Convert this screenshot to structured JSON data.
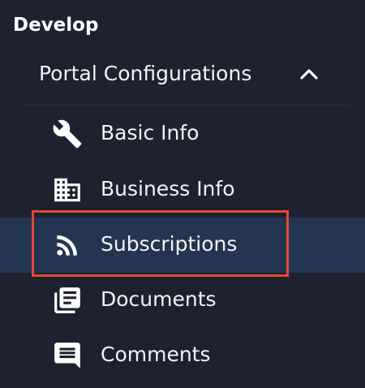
{
  "section": {
    "title": "Develop"
  },
  "group": {
    "label": "Portal Configurations",
    "expanded": true,
    "chevron_icon": "chevron-up-icon"
  },
  "items": [
    {
      "label": "Basic Info",
      "icon": "wrench-icon",
      "active": false
    },
    {
      "label": "Business Info",
      "icon": "building-icon",
      "active": false
    },
    {
      "label": "Subscriptions",
      "icon": "rss-feed-icon",
      "active": true
    },
    {
      "label": "Documents",
      "icon": "library-books-icon",
      "active": false
    },
    {
      "label": "Comments",
      "icon": "comment-icon",
      "active": false
    }
  ],
  "colors": {
    "background": "#1d2130",
    "active_background": "#243552",
    "highlight_border": "#e14a34",
    "text": "#f2f3f5"
  }
}
